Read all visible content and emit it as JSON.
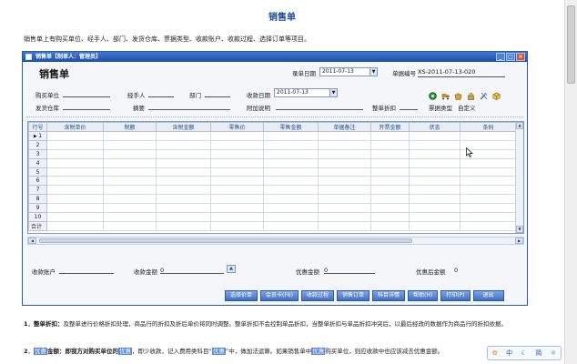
{
  "doc": {
    "title": "销售单",
    "intro": "销售单上有购买单位、经手人、部门、发货仓库、票据类型、收款账户、收款过程、选择订单等项目。"
  },
  "window": {
    "title": "销售单【制单人：管理员】",
    "form_title": "销售单"
  },
  "header": {
    "entry_date_label": "录单日期",
    "entry_date_value": "2011-07-13",
    "bill_no_label": "单据编号",
    "bill_no_value": "XS-2011-07-13-020"
  },
  "fields": {
    "buyer_label": "购买单位",
    "handler_label": "经手人",
    "dept_label": "部门",
    "receipt_date_label": "收款日期",
    "receipt_date_value": "2011-07-13",
    "warehouse_label": "发货仓库",
    "summary_label": "摘要",
    "extra_label": "附加说明",
    "discount_label": "整单折扣",
    "bill_type_label": "票据类型",
    "bill_type_value": "自定义"
  },
  "grid": {
    "columns": [
      "行号",
      "含税单价",
      "税额",
      "含税金额",
      "零售价",
      "零售金额",
      "单据备注",
      "开票金额",
      "状态",
      "条码"
    ],
    "rows": [
      "1",
      "2",
      "3",
      "4",
      "5",
      "6",
      "7",
      "8",
      "9",
      "10"
    ],
    "total_label": "合计"
  },
  "footer": {
    "account_label": "收款账户",
    "amount_label": "收款金额",
    "amount_value": "0",
    "disc_amount_label": "优惠金额",
    "disc_amount_value": "0",
    "after_disc_label": "优惠后金额",
    "after_disc_value": "0"
  },
  "buttons": [
    "选择价单",
    "会员卡(F6)",
    "收款过程",
    "销售订单",
    "科目详情",
    "帮助(H)",
    "打印(P)",
    "退出"
  ],
  "notes": {
    "p1_title": "1．整单折扣：",
    "p1_text": "及整单进行价格折扣处理，商品行的折扣及折后单价将同时调整。整单折扣不会控制单品折扣，当整单折扣与单品折扣冲突后，以最后经改的数据作为商品行的折扣依据。",
    "p2_num": "2．",
    "p2_hl1": "优惠",
    "p2_t1": "金额：即我方对购买单位的",
    "p2_hl2": "优惠",
    "p2_t2": "，即少收款，记入费用类科目“",
    "p2_hl3": "优惠",
    "p2_t3": "”中，做加法运算。如果销售单中",
    "p2_hl4": "优惠",
    "p2_t4": "购买单位，则应收款中也应该减去优惠金额。"
  },
  "ime": [
    "中",
    "简",
    "☼"
  ],
  "colors": {
    "accent": "#1f4d99",
    "titlebar": "#2b5aa8",
    "button": "#3f6fc6"
  }
}
